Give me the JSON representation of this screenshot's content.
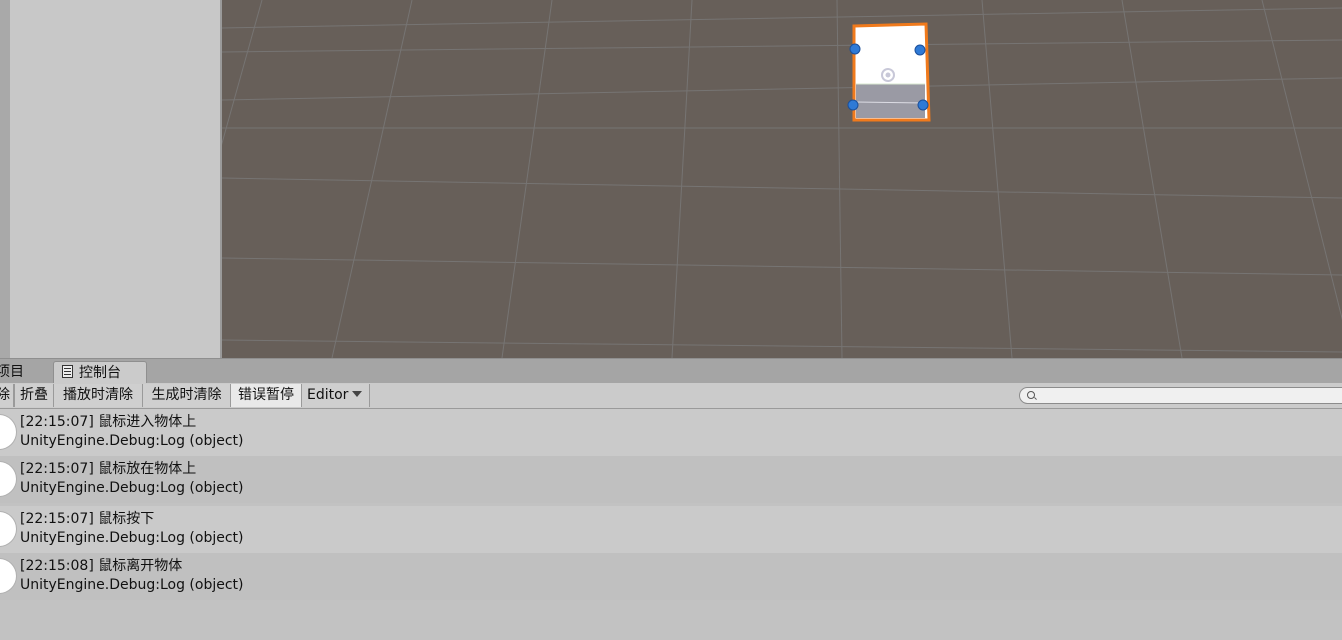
{
  "tabs": {
    "project_label": "项目",
    "console_label": "控制台"
  },
  "toolbar": {
    "clear_label": "除",
    "collapse_label": "折叠",
    "clear_on_play_label": "播放时清除",
    "clear_on_build_label": "生成时清除",
    "error_pause_label": "错误暂停",
    "editor_dropdown_label": "Editor"
  },
  "search": {
    "value": "",
    "placeholder": ""
  },
  "logs": [
    {
      "time": "[22:15:07]",
      "message": "鼠标进入物体上",
      "source": "UnityEngine.Debug:Log (object)"
    },
    {
      "time": "[22:15:07]",
      "message": "鼠标放在物体上",
      "source": "UnityEngine.Debug:Log (object)"
    },
    {
      "time": "[22:15:07]",
      "message": "鼠标按下",
      "source": "UnityEngine.Debug:Log (object)"
    },
    {
      "time": "[22:15:08]",
      "message": "鼠标离开物体",
      "source": "UnityEngine.Debug:Log (object)"
    }
  ],
  "icons": {
    "log": "info-speech-bubble-icon",
    "console": "console-icon",
    "search": "search-icon"
  },
  "colors": {
    "scene_background": "#675f59",
    "grid_line": "#7c7c7c",
    "selection_outline": "#f07a1c",
    "handle": "#2f7ad6"
  }
}
